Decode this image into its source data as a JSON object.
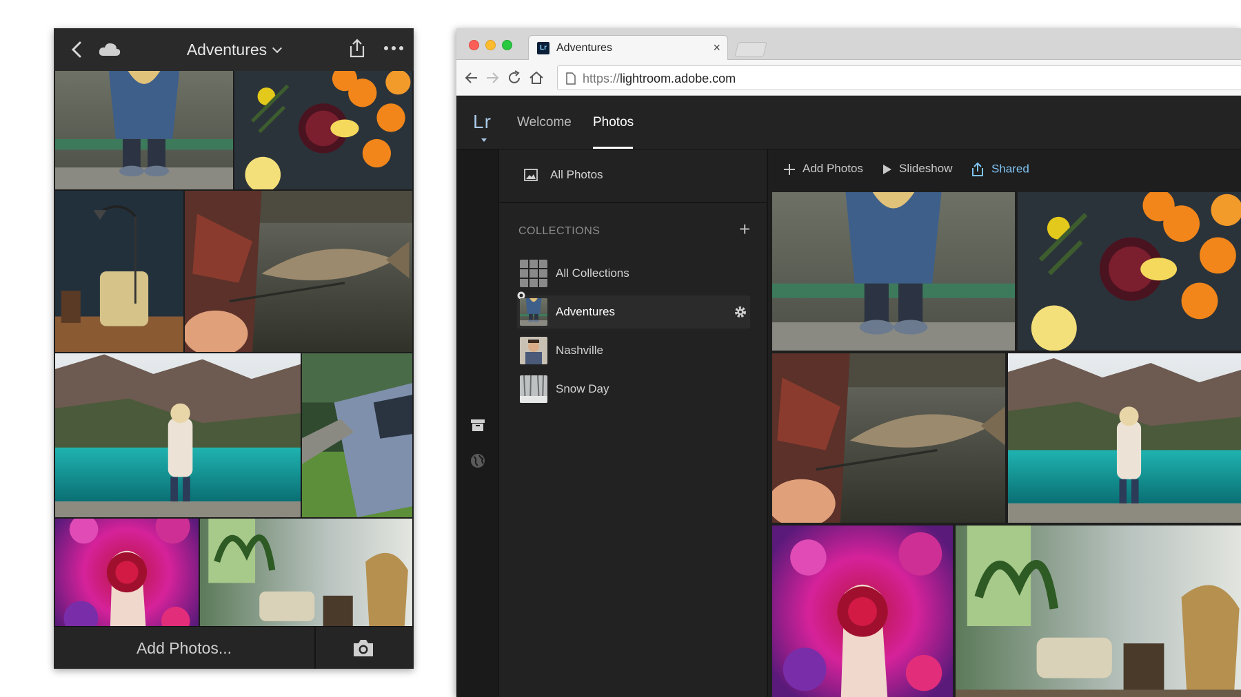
{
  "colors": {
    "phone_bg": "#1c1c1c",
    "app_bg": "#1e1e1e",
    "panel_bg": "#222222",
    "accent_blue": "#7fc4f4",
    "lr_logo": "#a9c9e6"
  },
  "mobile": {
    "title": "Adventures",
    "icons": [
      "chevron-left-icon",
      "cloud-icon",
      "chevron-down-icon",
      "share-icon",
      "more-icon",
      "camera-icon"
    ],
    "add_photos_label": "Add Photos...",
    "photos": [
      "girl-tying-boots",
      "sangria-oranges",
      "armchair-lamp",
      "fish-catch",
      "mountain-lake",
      "blue-truck",
      "flower-hand",
      "plant-room"
    ]
  },
  "browser": {
    "tab_title": "Adventures",
    "tab_favicon": "Lr",
    "tab_close": "×",
    "url_prefix": "https://",
    "url_host": "lightroom.adobe.com",
    "icons": [
      "back-icon",
      "forward-icon",
      "reload-icon",
      "home-icon",
      "page-icon"
    ]
  },
  "lightroom": {
    "logo": "Lr",
    "nav": {
      "welcome": "Welcome",
      "photos": "Photos"
    },
    "all_photos": "All Photos",
    "collections_heading": "COLLECTIONS",
    "collections_add": "+",
    "collections": [
      {
        "label": "All Collections"
      },
      {
        "label": "Adventures"
      },
      {
        "label": "Nashville"
      },
      {
        "label": "Snow Day"
      }
    ],
    "toolbar": {
      "add_photos": "Add Photos",
      "slideshow": "Slideshow",
      "shared": "Shared"
    },
    "grid_photos": [
      "girl-tying-boots",
      "sangria-oranges",
      "fish-catch",
      "mountain-lake",
      "flower-hand",
      "plant-room"
    ]
  }
}
